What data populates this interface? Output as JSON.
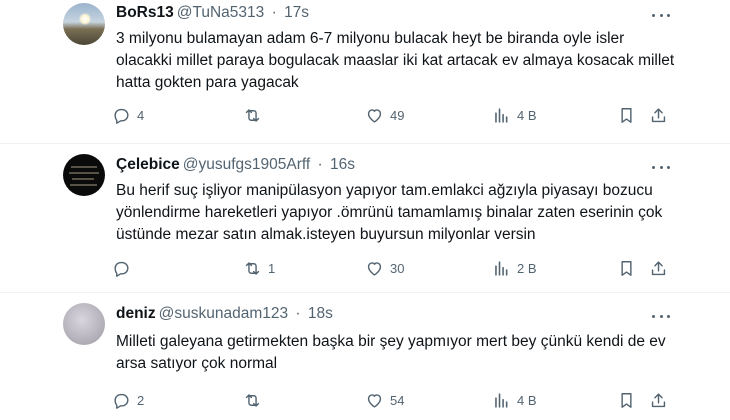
{
  "tweets": [
    {
      "name": "BoRs13",
      "handle": "@TuNa5313",
      "time": "17s",
      "text": "3 milyonu bulamayan adam 6-7 milyonu bulacak heyt be biranda oyle isler olacakki millet paraya bogulacak maaslar iki kat artacak ev almaya kosacak millet hatta gokten para yagacak",
      "replies": "4",
      "retweets": "",
      "likes": "49",
      "views": "4 B"
    },
    {
      "name": "Çelebice",
      "handle": "@yusufgs1905Arff",
      "time": "16s",
      "text": "Bu herif suç işliyor manipülasyon yapıyor tam.emlakci ağzıyla piyasayı bozucu yönlendirme hareketleri yapıyor .ömrünü tamamlamış binalar zaten eserinin çok üstünde mezar satın almak.isteyen buyursun milyonlar versin",
      "replies": "",
      "retweets": "1",
      "likes": "30",
      "views": "2 B"
    },
    {
      "name": "deniz",
      "handle": "@suskunadam123",
      "time": "18s",
      "text": "Milleti galeyana getirmekten başka bir şey yapmıyor mert bey çünkü kendi de ev arsa satıyor çok normal",
      "replies": "2",
      "retweets": "",
      "likes": "54",
      "views": "4 B"
    }
  ],
  "separator": "·",
  "icons": [
    "reply-icon",
    "retweet-icon",
    "like-icon",
    "views-icon",
    "bookmark-icon",
    "share-icon",
    "more-icon"
  ],
  "colors": {
    "text": "#0f1419",
    "secondary": "#536471",
    "divider": "#eff3f4",
    "background": "#ffffff"
  }
}
